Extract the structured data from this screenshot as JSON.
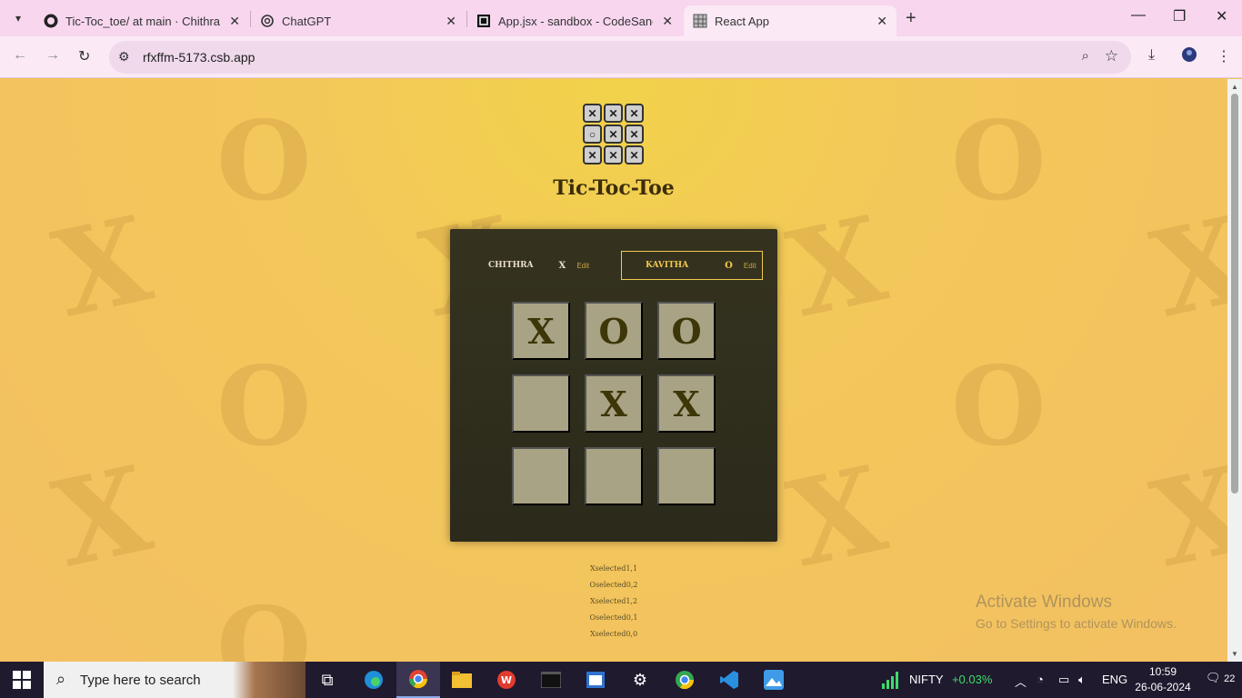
{
  "browser": {
    "tabs": [
      {
        "title": "Tic-Toc_toe/ at main · Chithra-A",
        "icon": "github-icon",
        "active": false
      },
      {
        "title": "ChatGPT",
        "icon": "chatgpt-icon",
        "active": false
      },
      {
        "title": "App.jsx - sandbox - CodeSandb",
        "icon": "codesandbox-icon",
        "active": false
      },
      {
        "title": "React App",
        "icon": "react-app-icon",
        "active": true
      }
    ],
    "url": "rfxffm-5173.csb.app"
  },
  "game": {
    "title": "Tic-Toc-Toe",
    "players": [
      {
        "name": "CHITHRA",
        "symbol": "X",
        "edit_label": "Edit",
        "active": false
      },
      {
        "name": "KAVITHA",
        "symbol": "O",
        "edit_label": "Edit",
        "active": true
      }
    ],
    "board": [
      [
        "X",
        "O",
        "O"
      ],
      [
        "",
        "X",
        "X"
      ],
      [
        "",
        "",
        ""
      ]
    ],
    "log": [
      "Xselected1,1",
      "Oselected0,2",
      "Xselected1,2",
      "Oselected0,1",
      "Xselected0,0"
    ]
  },
  "watermark": {
    "line1": "Activate Windows",
    "line2": "Go to Settings to activate Windows."
  },
  "taskbar": {
    "search_placeholder": "Type here to search",
    "nifty_label": "NIFTY",
    "nifty_value": "+0.03%",
    "language": "ENG",
    "time": "10:59",
    "date": "26-06-2024",
    "notifications": "22"
  },
  "colors": {
    "accent": "#f2c84f",
    "panel": "#2f2d1d",
    "cell": "#a9a385",
    "mark": "#3d3608"
  }
}
